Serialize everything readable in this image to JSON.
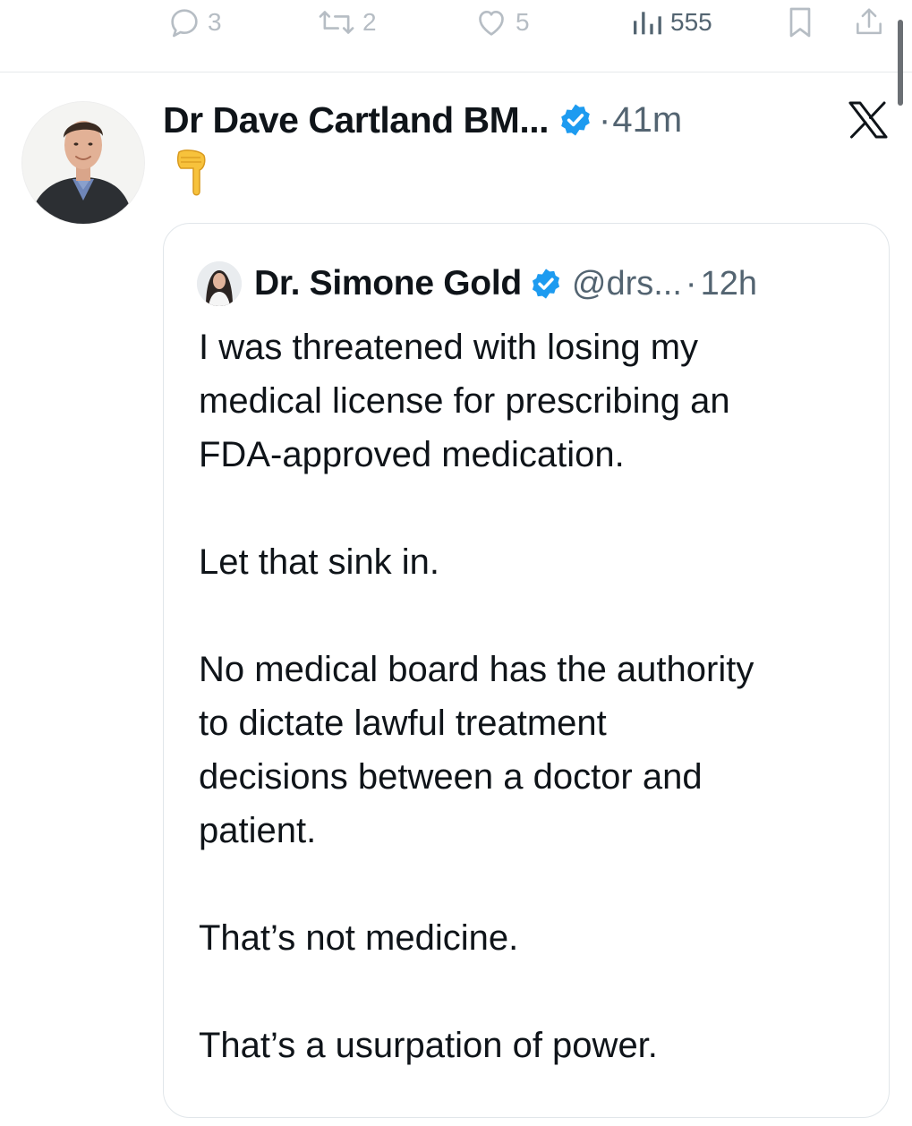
{
  "actions": {
    "reply_count": "3",
    "retweet_count": "2",
    "like_count": "5",
    "views_count": "555"
  },
  "tweet": {
    "author_name": "Dr Dave Cartland BM...",
    "separator": "·",
    "time": "41m",
    "emoji": "backhand-index-pointing-down"
  },
  "quote": {
    "author_name": "Dr. Simone Gold",
    "handle": "@drs...",
    "separator": "·",
    "time": "12h",
    "paragraphs": [
      "I was threatened with losing my\nmedical license for prescribing an\nFDA-approved medication.",
      "Let that sink in.",
      "No medical board has the authority\nto dictate lawful treatment\ndecisions between a doctor and\npatient.",
      "That’s not medicine.",
      "That’s a usurpation of power."
    ]
  },
  "colors": {
    "text": "#0f1419",
    "muted": "#536471",
    "icon_muted": "#b6bdc4",
    "verified": "#1d9bf0",
    "border": "#e1e6ea"
  },
  "icons": [
    "reply-icon",
    "retweet-icon",
    "like-icon",
    "views-icon",
    "bookmark-icon",
    "share-icon",
    "verified-icon",
    "x-logo-icon"
  ]
}
